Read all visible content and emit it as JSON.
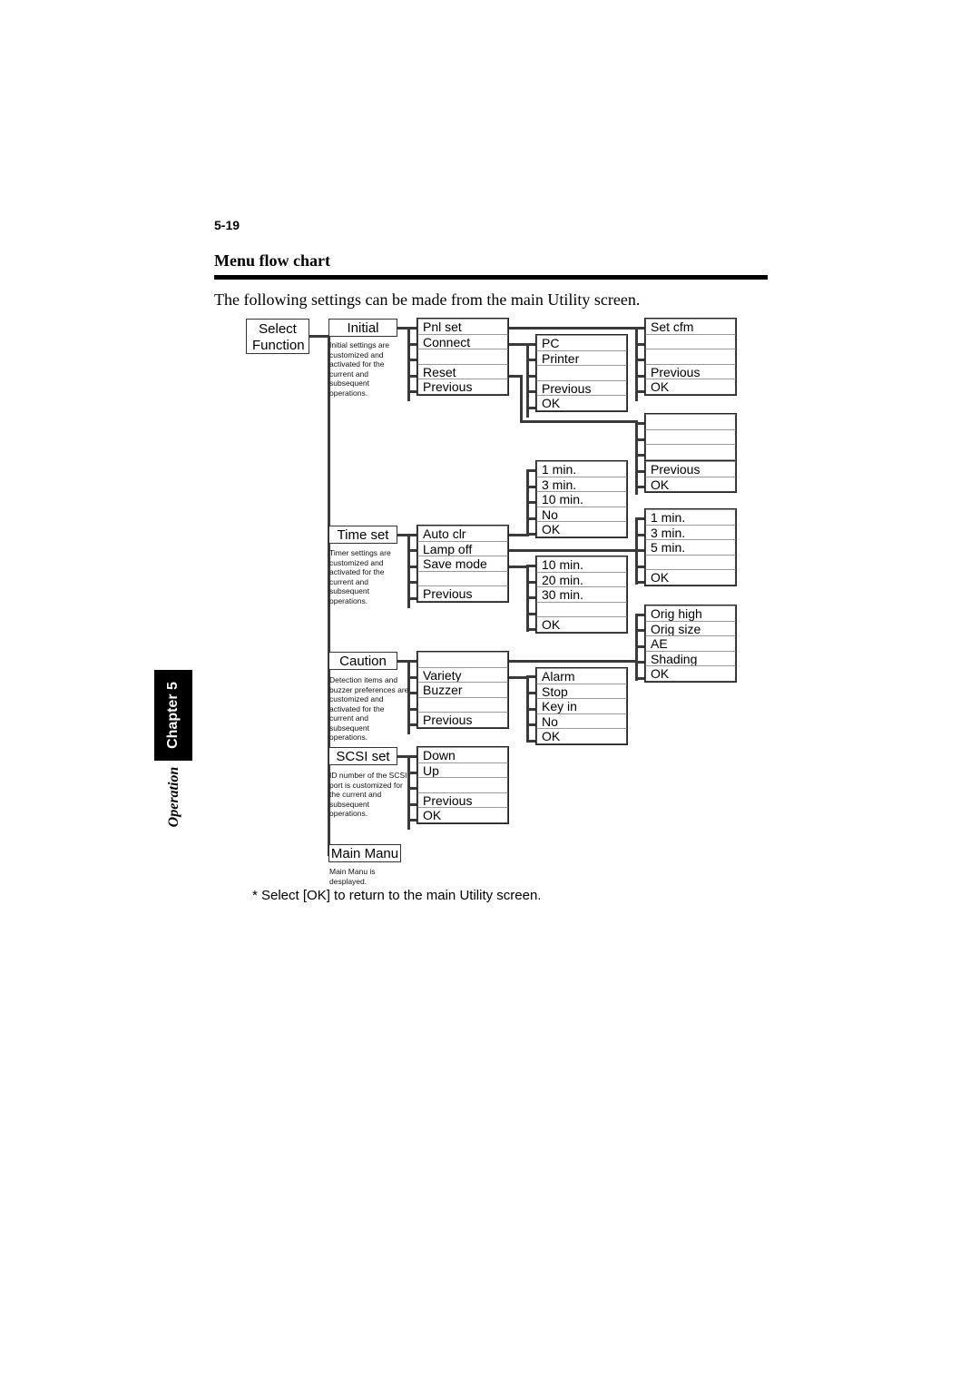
{
  "page": {
    "number": "5-19",
    "heading": "Menu flow chart",
    "intro": "The following settings can be made from the main Utility screen.",
    "footnote": "* Select [OK] to return to the main Utility screen.",
    "chapter_tab": "Chapter 5",
    "section_label": "Operation"
  },
  "nodes": {
    "select_function_line1": "Select",
    "select_function_line2": "Function",
    "initial": "Initial",
    "time_set": "Time set",
    "caution": "Caution",
    "scsi_set": "SCSI set",
    "main_manu": "Main Manu"
  },
  "captions": {
    "initial": "Initial settings are customized and activated for the current and subsequent operations.",
    "time_set": "Timer settings are customized and activated for the current and subsequent operations.",
    "caution": "Detection items and buzzer preferences are customized and activated for the current and subsequent operations.",
    "scsi_set": "ID number of the SCSI port is customized for the current and subsequent operations.",
    "main_manu": "Main Manu is desplayed."
  },
  "columns": {
    "initial_menu": [
      "Pnl set",
      "Connect",
      "",
      "Reset",
      "Previous"
    ],
    "connect_menu": [
      "PC",
      "Printer",
      "",
      "Previous",
      "OK"
    ],
    "set_cfm_menu": [
      "Set cfm",
      "",
      "",
      "Previous",
      "OK"
    ],
    "pnl_set_menu": [
      "",
      "",
      "",
      "Previous",
      "OK"
    ],
    "auto_clr_menu": [
      "1 min.",
      "3 min.",
      "10 min.",
      "No",
      "OK"
    ],
    "auto_clr_prev": [
      "Previous",
      "OK"
    ],
    "lamp_off_menu": [
      "1 min.",
      "3 min.",
      "5 min.",
      "",
      "OK"
    ],
    "time_set_menu": [
      "Auto clr",
      "Lamp off",
      "Save mode",
      "",
      "Previous"
    ],
    "save_mode_menu": [
      "10 min.",
      "20 min.",
      "30 min.",
      "",
      "OK"
    ],
    "orig_menu": [
      "Orig high",
      "Orig size",
      "AE",
      "Shading",
      "OK"
    ],
    "caution_menu": [
      "",
      "Variety",
      "Buzzer",
      "",
      "Previous"
    ],
    "variety_menu": [
      "Alarm",
      "Stop",
      "Key in",
      "No",
      "OK"
    ],
    "scsi_menu": [
      "Down",
      "Up",
      "",
      "Previous",
      "OK"
    ]
  }
}
